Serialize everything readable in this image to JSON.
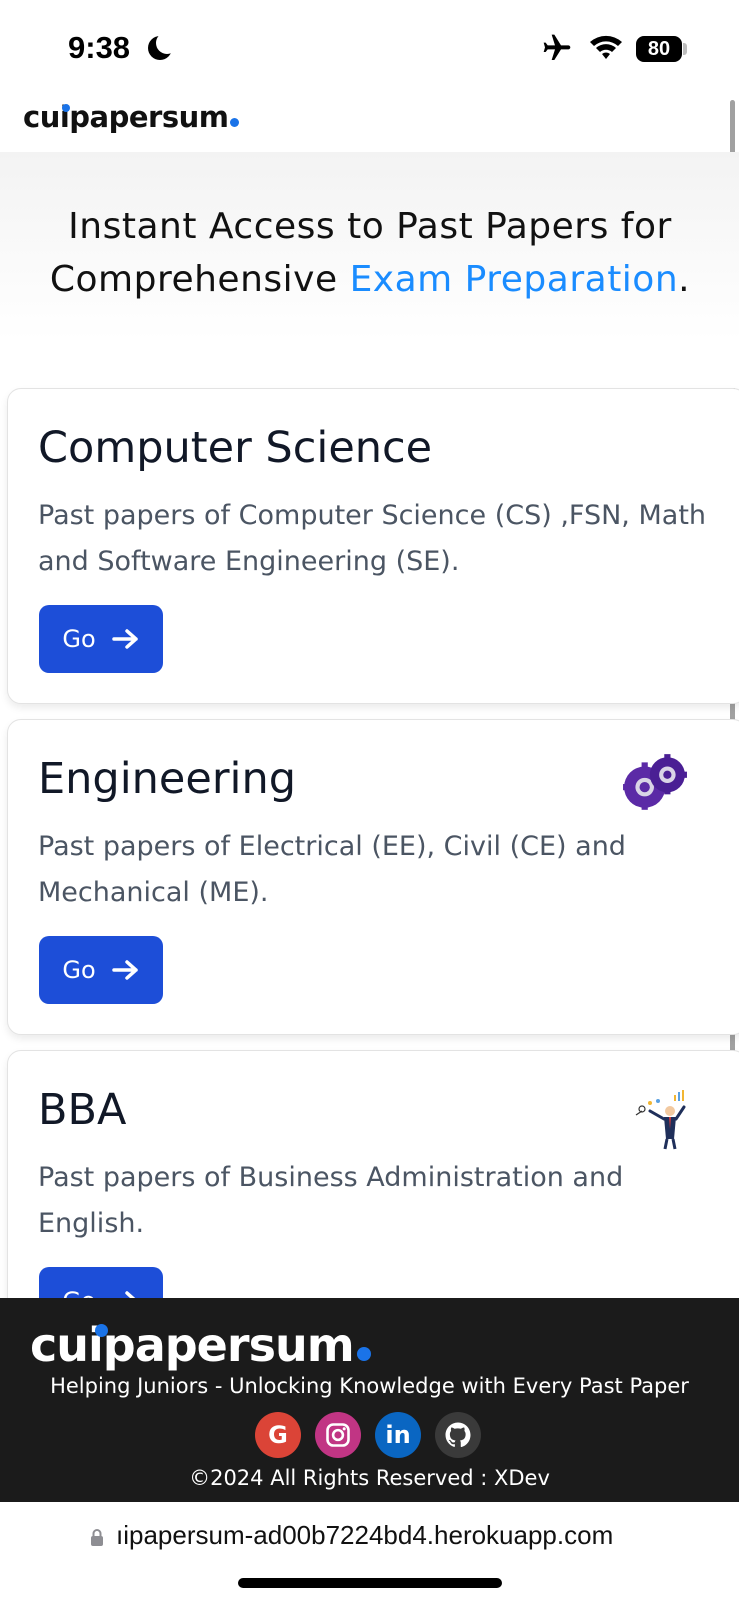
{
  "status_bar": {
    "time": "9:38",
    "battery": "80"
  },
  "header": {
    "logo": "cuipapersum"
  },
  "hero": {
    "title_part1": "Instant Access to Past Papers for Comprehensive ",
    "title_accent": "Exam Preparation",
    "title_end": "."
  },
  "cards": [
    {
      "title": "Computer Science",
      "description": "Past papers of Computer Science (CS) ,FSN, Math and Software Engineering (SE).",
      "button": "Go"
    },
    {
      "title": "Engineering",
      "description": "Past papers of Electrical (EE), Civil (CE) and Mechanical (ME).",
      "button": "Go",
      "icon": "gears-icon"
    },
    {
      "title": "BBA",
      "description": "Past papers of Business Administration and English.",
      "button": "Go",
      "icon": "businessman-icon"
    }
  ],
  "footer": {
    "logo": "cuipapersum",
    "tagline": "Helping Juniors - Unlocking Knowledge with Every Past Paper",
    "social": [
      {
        "name": "google",
        "glyph": "G"
      },
      {
        "name": "instagram",
        "glyph": ""
      },
      {
        "name": "linkedin",
        "glyph": "in"
      },
      {
        "name": "github",
        "glyph": ""
      }
    ],
    "copyright": "©2024 All Rights Reserved : XDev"
  },
  "url_bar": {
    "url": "ıipapersum-ad00b7224bd4.herokuapp.com"
  },
  "colors": {
    "accent": "#1a8cff",
    "button": "#1d4ed8",
    "footer_bg": "#1b1b1b",
    "logo_dot": "#1a73e8"
  }
}
